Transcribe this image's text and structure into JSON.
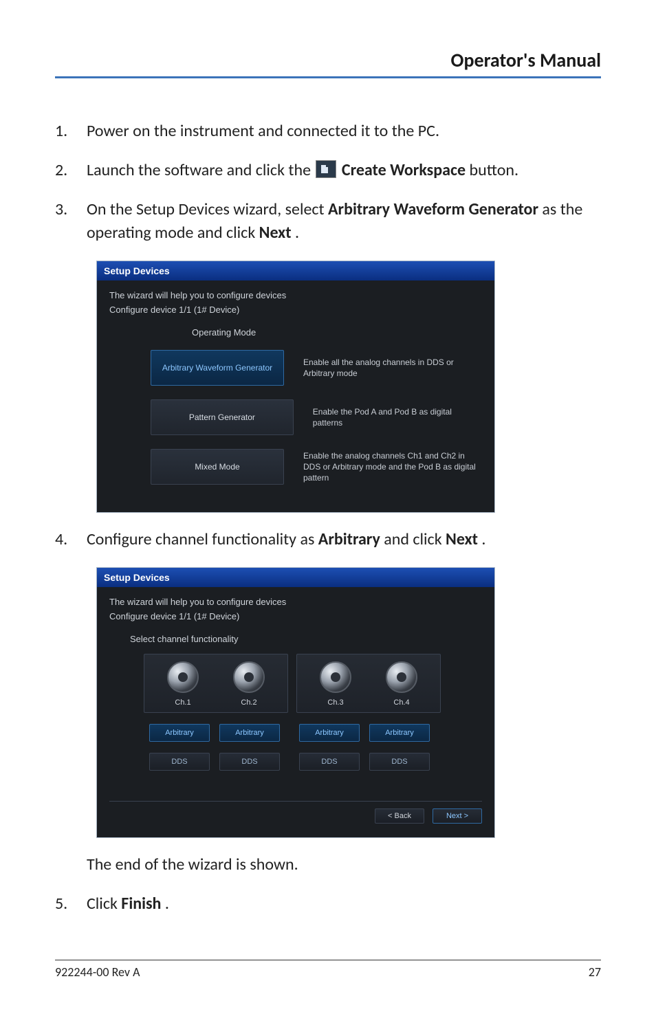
{
  "header": {
    "title": "Operator's Manual"
  },
  "steps": {
    "s1": {
      "num": "1.",
      "text": "Power on the instrument and connected it to the PC."
    },
    "s2": {
      "num": "2.",
      "pre": "Launch the software and click the ",
      "bold": "Create Workspace",
      "post": " button."
    },
    "s3": {
      "num": "3.",
      "pre": "On the Setup Devices wizard, select ",
      "bold": "Arbitrary Waveform Generator",
      "mid": " as the operating mode and click ",
      "bold2": "Next",
      "post": "."
    },
    "s4": {
      "num": "4.",
      "pre": "Configure channel functionality as ",
      "bold": "Arbitrary",
      "mid": " and click ",
      "bold2": "Next",
      "post": "."
    },
    "s4b": {
      "text": "The end of the wizard is shown."
    },
    "s5": {
      "num": "5.",
      "pre": "Click ",
      "bold": "Finish",
      "post": "."
    }
  },
  "panel1": {
    "title": "Setup Devices",
    "line1": "The wizard will help you to configure devices",
    "line2": "Configure device 1/1 (1# Device)",
    "label": "Operating Mode",
    "modes": [
      {
        "name": "Arbitrary Waveform Generator",
        "desc": "Enable all the analog channels in DDS or Arbitrary mode",
        "selected": true
      },
      {
        "name": "Pattern Generator",
        "desc": "Enable the Pod A and Pod B as digital patterns",
        "selected": false
      },
      {
        "name": "Mixed Mode",
        "desc": "Enable the analog channels Ch1 and Ch2 in DDS or Arbitrary mode and the Pod B as digital pattern",
        "selected": false
      }
    ]
  },
  "panel2": {
    "title": "Setup Devices",
    "line1": "The wizard will help you to configure devices",
    "line2": "Configure device 1/1 (1# Device)",
    "label": "Select channel functionality",
    "channels": [
      "Ch.1",
      "Ch.2",
      "Ch.3",
      "Ch.4"
    ],
    "funcs": {
      "arb": "Arbitrary",
      "dds": "DDS"
    },
    "nav": {
      "back": "< Back",
      "next": "Next >"
    }
  },
  "footer": {
    "left": "922244-00 Rev A",
    "right": "27"
  }
}
